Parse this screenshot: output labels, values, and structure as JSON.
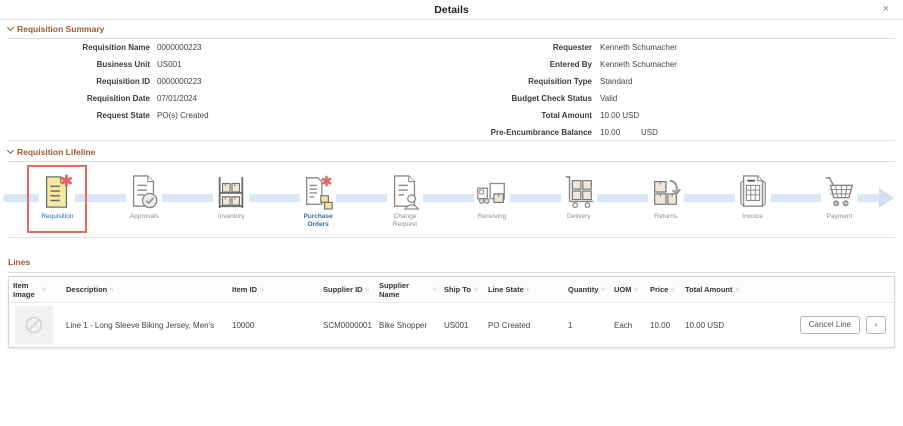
{
  "modal": {
    "title": "Details",
    "close_glyph": "×"
  },
  "summary": {
    "title": "Requisition Summary",
    "left_fields": [
      {
        "label": "Requisition Name",
        "value": "0000000223"
      },
      {
        "label": "Business Unit",
        "value": "US001"
      },
      {
        "label": "Requisition ID",
        "value": "0000000223"
      },
      {
        "label": "Requisition Date",
        "value": "07/01/2024"
      },
      {
        "label": "Request State",
        "value": "PO(s) Created"
      }
    ],
    "right_fields": [
      {
        "label": "Requester",
        "value": "Kenneth Schumacher"
      },
      {
        "label": "Entered By",
        "value": "Kenneth Schumacher"
      },
      {
        "label": "Requisition Type",
        "value": "Standard"
      },
      {
        "label": "Budget Check Status",
        "value": "Valid"
      },
      {
        "label": "Total Amount",
        "value": "10.00 USD"
      },
      {
        "label": "Pre-Encumbrance Balance",
        "value": "10.00",
        "suffix": "USD"
      }
    ]
  },
  "lifeline": {
    "title": "Requisition Lifeline",
    "stages": [
      {
        "label": "Requisition",
        "icon": "requisition-document-icon"
      },
      {
        "label": "Approvals",
        "icon": "approvals-check-icon"
      },
      {
        "label": "Inventory",
        "icon": "inventory-shelf-icon"
      },
      {
        "label": "Purchase Orders",
        "icon": "purchase-orders-icon"
      },
      {
        "label": "Change Request",
        "icon": "change-request-icon"
      },
      {
        "label": "Receiving",
        "icon": "receiving-truck-icon"
      },
      {
        "label": "Delivery",
        "icon": "delivery-cart-icon"
      },
      {
        "label": "Returns",
        "icon": "returns-boxes-icon"
      },
      {
        "label": "Invoice",
        "icon": "invoice-receipt-icon"
      },
      {
        "label": "Payment",
        "icon": "payment-cart-icon"
      }
    ]
  },
  "lines": {
    "title": "Lines",
    "sort_glyph": "↑↓",
    "columns": [
      "Item Image",
      "Description",
      "Item ID",
      "Supplier ID",
      "Supplier Name",
      "Ship To",
      "Line State",
      "Quantity",
      "UOM",
      "Price",
      "Total Amount"
    ],
    "rows": [
      {
        "item_image_icon": "no-image-placeholder-icon",
        "description": "Line 1 - Long Sleeve Biking Jersey, Men's",
        "item_id": "10000",
        "supplier_id": "SCM0000001",
        "supplier_name": "Bike Shopper",
        "ship_to": "US001",
        "line_state": "PO Created",
        "quantity": "1",
        "uom": "Each",
        "price": "10.00",
        "total_amount": "10.00 USD",
        "cancel_label": "Cancel Line",
        "more_glyph": "›"
      }
    ]
  },
  "colors": {
    "section_accent": "#9c5b31",
    "link_blue": "#2e6fb0",
    "lifeline_bar": "#d9e6f6",
    "current_stage_highlight": "#e36a5e",
    "requisition_yellow": "#f6e9a2",
    "asterisk_red": "#e2685e"
  }
}
